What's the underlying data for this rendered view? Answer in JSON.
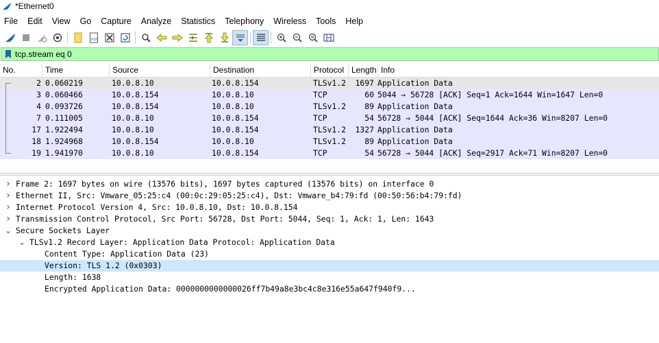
{
  "window": {
    "title": "*Ethernet0"
  },
  "menu": [
    "File",
    "Edit",
    "View",
    "Go",
    "Capture",
    "Analyze",
    "Statistics",
    "Telephony",
    "Wireless",
    "Tools",
    "Help"
  ],
  "toolbar": {
    "icons": [
      "shark-fin-start-icon",
      "stop-capture-icon",
      "restart-capture-icon",
      "capture-options-icon",
      "open-file-icon",
      "save-file-icon",
      "close-file-icon",
      "reload-file-icon",
      "find-packet-icon",
      "go-back-icon",
      "go-forward-icon",
      "go-to-packet-icon",
      "go-first-icon",
      "go-last-icon",
      "autoscroll-icon",
      "colorize-icon",
      "zoom-in-icon",
      "zoom-out-icon",
      "zoom-normal-icon",
      "resize-columns-icon"
    ]
  },
  "filter": {
    "value": "tcp.stream eq 0"
  },
  "packet_list": {
    "columns": [
      "No.",
      "Time",
      "Source",
      "Destination",
      "Protocol",
      "Length",
      "Info"
    ],
    "rows": [
      {
        "no": "2",
        "time": "0.060219",
        "src": "10.0.8.10",
        "dst": "10.0.8.154",
        "proto": "TLSv1.2",
        "len": "1697",
        "info": "Application Data"
      },
      {
        "no": "3",
        "time": "0.060466",
        "src": "10.0.8.154",
        "dst": "10.0.8.10",
        "proto": "TCP",
        "len": "60",
        "info": "5044 → 56728 [ACK] Seq=1 Ack=1644 Win=1647 Len=0"
      },
      {
        "no": "4",
        "time": "0.093726",
        "src": "10.0.8.154",
        "dst": "10.0.8.10",
        "proto": "TLSv1.2",
        "len": "89",
        "info": "Application Data"
      },
      {
        "no": "7",
        "time": "0.111005",
        "src": "10.0.8.10",
        "dst": "10.0.8.154",
        "proto": "TCP",
        "len": "54",
        "info": "56728 → 5044 [ACK] Seq=1644 Ack=36 Win=8207 Len=0"
      },
      {
        "no": "17",
        "time": "1.922494",
        "src": "10.0.8.10",
        "dst": "10.0.8.154",
        "proto": "TLSv1.2",
        "len": "1327",
        "info": "Application Data"
      },
      {
        "no": "18",
        "time": "1.924968",
        "src": "10.0.8.154",
        "dst": "10.0.8.10",
        "proto": "TLSv1.2",
        "len": "89",
        "info": "Application Data"
      },
      {
        "no": "19",
        "time": "1.941970",
        "src": "10.0.8.10",
        "dst": "10.0.8.154",
        "proto": "TCP",
        "len": "54",
        "info": "56728 → 5044 [ACK] Seq=2917 Ack=71 Win=8207 Len=0"
      }
    ]
  },
  "detail_tree": [
    {
      "text": "Frame 2: 1697 bytes on wire (13576 bits), 1697 bytes captured (13576 bits) on interface 0",
      "level": 0,
      "state": "collapsed"
    },
    {
      "text": "Ethernet II, Src: Vmware_05:25:c4 (00:0c:29:05:25:c4), Dst: Vmware_b4:79:fd (00:50:56:b4:79:fd)",
      "level": 0,
      "state": "collapsed"
    },
    {
      "text": "Internet Protocol Version 4, Src: 10.0.8.10, Dst: 10.0.8.154",
      "level": 0,
      "state": "collapsed"
    },
    {
      "text": "Transmission Control Protocol, Src Port: 56728, Dst Port: 5044, Seq: 1, Ack: 1, Len: 1643",
      "level": 0,
      "state": "collapsed"
    },
    {
      "text": "Secure Sockets Layer",
      "level": 0,
      "state": "expanded"
    },
    {
      "text": "TLSv1.2 Record Layer: Application Data Protocol: Application Data",
      "level": 1,
      "state": "expanded"
    },
    {
      "text": "Content Type: Application Data (23)",
      "level": 2,
      "state": "leaf"
    },
    {
      "text": "Version: TLS 1.2 (0x0303)",
      "level": 2,
      "state": "leaf",
      "selected": true
    },
    {
      "text": "Length: 1638",
      "level": 2,
      "state": "leaf"
    },
    {
      "text": "Encrypted Application Data: 0000000000000026ff7b49a8e3bc4c8e316e55a647f940f9...",
      "level": 2,
      "state": "leaf"
    }
  ]
}
